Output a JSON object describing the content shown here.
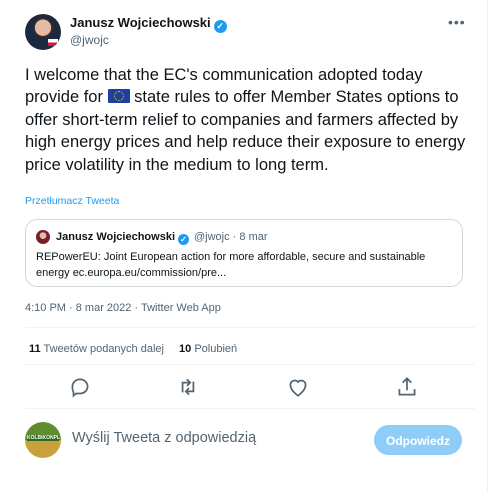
{
  "author": {
    "name": "Janusz Wojciechowski",
    "handle": "@jwojc",
    "verified": true
  },
  "tweet": {
    "text_before_flag": "I welcome that the EC's communication adopted today provide for",
    "flag_emoji": "eu-flag",
    "text_after_flag": "state rules to offer Member States options to offer short-term relief to companies and farmers affected by high energy prices and help reduce their exposure to energy price volatility in the medium to long term.",
    "translate_link": "Przetłumacz Tweeta"
  },
  "quoted_tweet": {
    "name": "Janusz Wojciechowski",
    "handle_date": "@jwojc · 8 mar",
    "text": "REPowerEU: Joint European action for more affordable, secure and sustainable energy ec.europa.eu/commission/pre..."
  },
  "meta": {
    "timestamp_source": "4:10 PM · 8 mar 2022 · Twitter Web App"
  },
  "stats": {
    "retweets_count": "11",
    "retweets_label": "Tweetów podanych dalej",
    "likes_count": "10",
    "likes_label": "Polubień"
  },
  "actions": [
    "reply-icon",
    "retweet-icon",
    "like-icon",
    "share-icon"
  ],
  "compose": {
    "avatar_label": "KOLBIKONPL",
    "placeholder": "Wyślij Tweeta z odpowiedzią",
    "button_label": "Odpowiedz"
  },
  "colors": {
    "accent": "#1d9bf0",
    "button_disabled": "#8ecdf8",
    "secondary_text": "#536471"
  }
}
